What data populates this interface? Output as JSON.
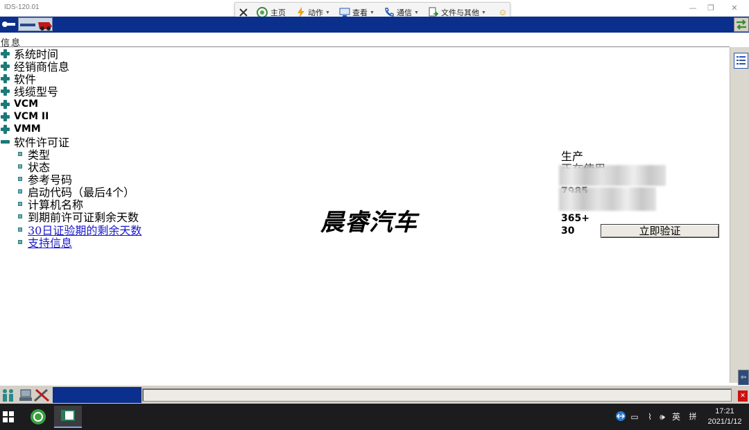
{
  "window": {
    "title": "IDS-120.01"
  },
  "remote_toolbar": {
    "items": [
      {
        "label": "主页",
        "icon": "home-icon"
      },
      {
        "label": "动作",
        "icon": "lightning-icon"
      },
      {
        "label": "查看",
        "icon": "monitor-icon"
      },
      {
        "label": "通信",
        "icon": "phone-icon"
      },
      {
        "label": "文件与其他",
        "icon": "file-transfer-icon"
      }
    ],
    "smiley": "☺",
    "sub_controls": "⤢ ︿"
  },
  "section": {
    "title": "信息"
  },
  "tree": {
    "groups": [
      {
        "label": "系统时间",
        "expanded": false
      },
      {
        "label": "经销商信息",
        "expanded": false
      },
      {
        "label": "软件",
        "expanded": false
      },
      {
        "label": "线缆型号",
        "expanded": false
      },
      {
        "label": "VCM",
        "expanded": false
      },
      {
        "label": "VCM II",
        "expanded": false
      },
      {
        "label": "VMM",
        "expanded": false
      },
      {
        "label": "软件许可证",
        "expanded": true
      }
    ],
    "license_items": [
      {
        "label": "类型",
        "value": "生产"
      },
      {
        "label": "状态",
        "value": "正在使用"
      },
      {
        "label": "参考号码",
        "value": ""
      },
      {
        "label": "启动代码（最后4个）",
        "value": "7985"
      },
      {
        "label": "计算机名称",
        "value": ""
      },
      {
        "label": "到期前许可证剩余天数",
        "value": "365+"
      },
      {
        "label": "30日证验期的剩余天数",
        "value": "30",
        "link": true
      },
      {
        "label": "支持信息",
        "link": true
      }
    ]
  },
  "verify_button": {
    "label": "立即验证"
  },
  "watermark": "晨睿汽车",
  "taskbar": {
    "ime": "英",
    "ime2": "拼",
    "time": "17:21",
    "date": "2021/1/12"
  },
  "colors": {
    "app_bar": "#0a2f8c",
    "tree_icon": "#1a7a7a",
    "link": "#1a1acc"
  }
}
